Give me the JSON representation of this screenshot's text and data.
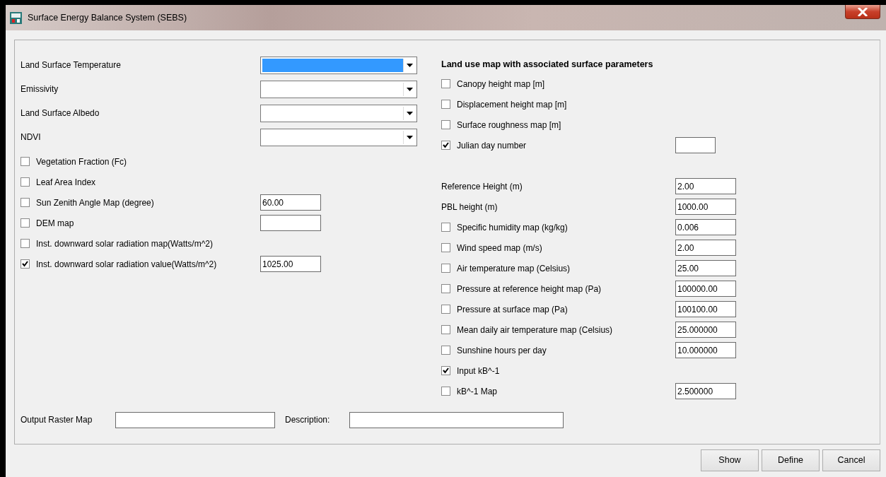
{
  "window": {
    "title": "Surface Energy Balance System (SEBS)"
  },
  "left": {
    "combos": [
      {
        "label": "Land Surface Temperature",
        "highlighted": true
      },
      {
        "label": "Emissivity",
        "highlighted": false
      },
      {
        "label": "Land Surface Albedo",
        "highlighted": false
      },
      {
        "label": "NDVI",
        "highlighted": false
      }
    ],
    "options": [
      {
        "label": "Vegetation Fraction (Fc)",
        "checked": false,
        "field": false
      },
      {
        "label": "Leaf Area Index",
        "checked": false,
        "field": false
      },
      {
        "label": "Sun Zenith Angle Map (degree)",
        "checked": false,
        "field": true,
        "value": "60.00"
      },
      {
        "label": "DEM map",
        "checked": false,
        "field": true
      },
      {
        "label": "Inst. downward solar radiation map(Watts/m^2)",
        "checked": false,
        "field": false
      },
      {
        "label": "Inst. downward solar radiation value(Watts/m^2)",
        "checked": true,
        "field": true,
        "value": "1025.00"
      }
    ]
  },
  "right": {
    "heading": "Land use map with associated surface parameters",
    "land_use": [
      {
        "kind": "checkbox",
        "label": "Canopy height map [m]",
        "checked": false,
        "field": false
      },
      {
        "kind": "checkbox",
        "label": "Displacement height map [m]",
        "checked": false,
        "field": false
      },
      {
        "kind": "checkbox",
        "label": "Surface roughness map [m]",
        "checked": false,
        "field": false
      },
      {
        "kind": "checkbox",
        "label": "Julian day number",
        "checked": true,
        "field": true
      }
    ],
    "parameters": [
      {
        "kind": "label",
        "label": "Reference Height (m)",
        "field": true,
        "value": "2.00"
      },
      {
        "kind": "label",
        "label": "PBL height (m)",
        "field": true,
        "value": "1000.00"
      },
      {
        "kind": "checkbox",
        "label": "Specific humidity map (kg/kg)",
        "checked": false,
        "field": true,
        "value": "0.006"
      },
      {
        "kind": "checkbox",
        "label": "Wind speed map (m/s)",
        "checked": false,
        "field": true,
        "value": "2.00"
      },
      {
        "kind": "checkbox",
        "label": "Air temperature map (Celsius)",
        "checked": false,
        "field": true,
        "value": "25.00"
      },
      {
        "kind": "checkbox",
        "label": "Pressure at reference height map (Pa)",
        "checked": false,
        "field": true,
        "value": "100000.00"
      },
      {
        "kind": "checkbox",
        "label": "Pressure at surface map (Pa)",
        "checked": false,
        "field": true,
        "value": "100100.00"
      },
      {
        "kind": "checkbox",
        "label": "Mean daily air temperature map (Celsius)",
        "checked": false,
        "field": true,
        "value": "25.000000"
      },
      {
        "kind": "checkbox",
        "label": "Sunshine hours per day",
        "checked": false,
        "field": true,
        "value": "10.000000"
      },
      {
        "kind": "checkbox",
        "label": "Input kB^-1",
        "checked": true,
        "field": false
      },
      {
        "kind": "checkbox",
        "label": "kB^-1 Map",
        "checked": false,
        "field": true,
        "value": "2.500000"
      }
    ]
  },
  "output": {
    "map_label": "Output Raster Map",
    "description_label": "Description:"
  },
  "buttons": [
    "Show",
    "Define",
    "Cancel"
  ]
}
